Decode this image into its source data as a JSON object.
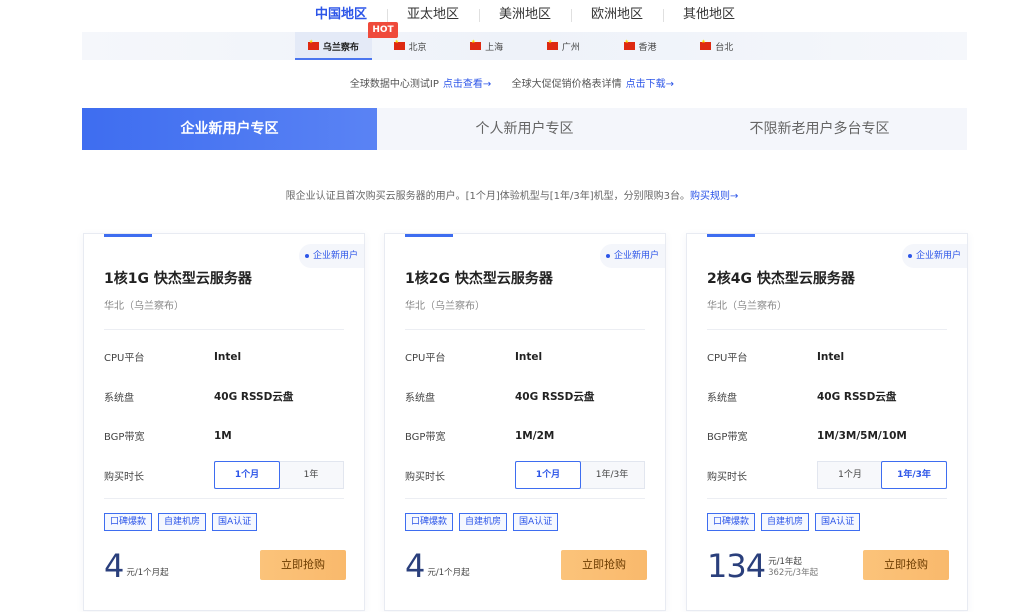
{
  "regions": [
    "中国地区",
    "亚太地区",
    "美洲地区",
    "欧洲地区",
    "其他地区"
  ],
  "hot_badge": "HOT",
  "cities": [
    "乌兰察布",
    "北京",
    "上海",
    "广州",
    "香港",
    "台北"
  ],
  "info": {
    "ip_text": "全球数据中心测试IP",
    "ip_link": "点击查看→",
    "price_text": "全球大促促销价格表详情",
    "price_link": "点击下载→"
  },
  "zones": [
    "企业新用户专区",
    "个人新用户专区",
    "不限新老用户多台专区"
  ],
  "zone_desc": {
    "text": "限企业认证且首次购买云服务器的用户。[1个月]体验机型与[1年/3年]机型，分别限购3台。",
    "link": "购买规则→"
  },
  "spec_labels": {
    "cpu": "CPU平台",
    "disk": "系统盘",
    "bandwidth": "BGP带宽",
    "duration": "购买时长"
  },
  "cards": [
    {
      "badge": "企业新用户",
      "title": "1核1G 快杰型云服务器",
      "region": "华北（乌兰察布）",
      "cpu": "Intel",
      "disk": "40G RSSD云盘",
      "bandwidth": "1M",
      "durations": [
        "1个月",
        "1年"
      ],
      "selected_duration": 0,
      "tags": [
        "口碑爆款",
        "自建机房",
        "国A认证"
      ],
      "price": "4",
      "unit": "元/1个月起",
      "sub_unit": "",
      "buy": "立即抢购"
    },
    {
      "badge": "企业新用户",
      "title": "1核2G 快杰型云服务器",
      "region": "华北（乌兰察布）",
      "cpu": "Intel",
      "disk": "40G RSSD云盘",
      "bandwidth": "1M/2M",
      "durations": [
        "1个月",
        "1年/3年"
      ],
      "selected_duration": 0,
      "tags": [
        "口碑爆款",
        "自建机房",
        "国A认证"
      ],
      "price": "4",
      "unit": "元/1个月起",
      "sub_unit": "",
      "buy": "立即抢购"
    },
    {
      "badge": "企业新用户",
      "title": "2核4G 快杰型云服务器",
      "region": "华北（乌兰察布）",
      "cpu": "Intel",
      "disk": "40G RSSD云盘",
      "bandwidth": "1M/3M/5M/10M",
      "durations": [
        "1个月",
        "1年/3年"
      ],
      "selected_duration": 1,
      "tags": [
        "口碑爆款",
        "自建机房",
        "国A认证"
      ],
      "price": "134",
      "unit": "元/1年起",
      "sub_unit": "362元/3年起",
      "buy": "立即抢购"
    }
  ],
  "colors": {
    "primary": "#3e6df0",
    "link": "#2c55e8",
    "buy": "#f9b96c",
    "hot": "#ef4a3b"
  }
}
